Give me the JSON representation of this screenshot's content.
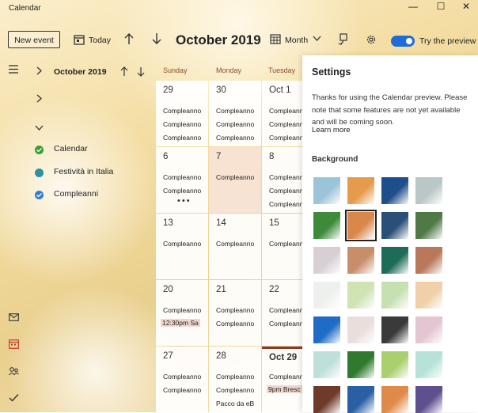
{
  "window": {
    "title": "Calendar",
    "controls": [
      "—",
      "☐",
      "✕"
    ]
  },
  "toolbar": {
    "new_event": "New event",
    "today": "Today",
    "month_title": "October 2019",
    "view": "Month",
    "try_preview": "Try the preview",
    "preview_enabled": true
  },
  "sidebar": {
    "mini_month": "October 2019",
    "calendars": [
      {
        "label": "Calendar",
        "color": "#3a9d3a"
      },
      {
        "label": "Festività in Italia",
        "color": "#2f8fa5"
      },
      {
        "label": "Compleanni",
        "color": "#2f7fd0"
      }
    ]
  },
  "grid": {
    "headers": [
      "Sunday",
      "Monday",
      "Tuesday"
    ],
    "weeks": [
      [
        {
          "day": "29",
          "events": [
            "Compleanno",
            "Compleanno",
            "Compleanno"
          ]
        },
        {
          "day": "30",
          "events": [
            "Compleanno",
            "Compleanno",
            "Compleanno"
          ]
        },
        {
          "day": "Oct 1",
          "events": [
            "Compleanno",
            "Compleanno",
            "Compleanno"
          ]
        }
      ],
      [
        {
          "day": "6",
          "events": [
            "Compleanno",
            "Compleanno"
          ],
          "more": "•••"
        },
        {
          "day": "7",
          "events": [
            "Compleanno"
          ]
        },
        {
          "day": "8",
          "events": [
            "Compleanno",
            "Compleanno",
            "Compleanno"
          ]
        }
      ],
      [
        {
          "day": "13",
          "events": [
            "Compleanno"
          ]
        },
        {
          "day": "14",
          "events": [
            "Compleanno"
          ]
        },
        {
          "day": "15",
          "events": [
            "Compleanno"
          ]
        }
      ],
      [
        {
          "day": "20",
          "events": [
            "Compleanno"
          ],
          "timed": "12:30pm  Sa"
        },
        {
          "day": "21",
          "events": [
            "Compleanno",
            "Compleanno"
          ]
        },
        {
          "day": "22",
          "events": [
            "Compleanno",
            "Compleanno"
          ]
        }
      ],
      [
        {
          "day": "27",
          "events": [
            "Compleanno",
            "Compleanno"
          ]
        },
        {
          "day": "28",
          "events": [
            "Compleanno",
            "Compleanno",
            "Pacco da eB"
          ]
        },
        {
          "day": "Oct 29",
          "events": [
            "Compleanno",
            "Compleanno"
          ],
          "timed": "9pm  Bresc"
        }
      ]
    ]
  },
  "settings": {
    "title": "Settings",
    "text": "Thanks for using the Calendar preview. Please note that some features are not yet available and will be coming soon.",
    "learn_more": "Learn more",
    "background_title": "Background",
    "swatches": [
      "#9cc4d8",
      "#e59a4c",
      "#1f4f8a",
      "#b9c8c6",
      "#3d8a3a",
      "#d9874a",
      "#2a4f78",
      "#4f7a48",
      "#d8cfd4",
      "#c88e6a",
      "#1f6b5a",
      "#b9785a",
      "#eef0ee",
      "#cfe3b4",
      "#c7e0b2",
      "#efd0a8",
      "#1e6cc6",
      "#eadedd",
      "#3a3a3a",
      "#e4c5d2",
      "#bfe0da",
      "#2f7a2f",
      "#a9cf6e",
      "#b6e2d8",
      "#6e3a2a",
      "#2a5fa5",
      "#e08a4a",
      "#5e4f8e"
    ],
    "selected_index": 5
  }
}
